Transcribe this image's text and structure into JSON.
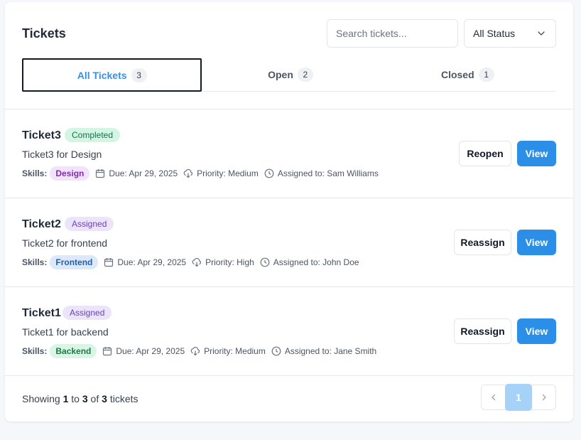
{
  "header": {
    "title": "Tickets",
    "search_placeholder": "Search tickets...",
    "status_filter": "All Status"
  },
  "tabs": [
    {
      "label": "All Tickets",
      "count": "3"
    },
    {
      "label": "Open",
      "count": "2"
    },
    {
      "label": "Closed",
      "count": "1"
    }
  ],
  "tickets": [
    {
      "name": "Ticket3",
      "status": "Completed",
      "description": "Ticket3 for Design",
      "skills_label": "Skills:",
      "skill": "Design",
      "due": "Due: Apr 29, 2025",
      "priority": "Priority: Medium",
      "assigned": "Assigned to: Sam Williams",
      "action": "Reopen",
      "view": "View"
    },
    {
      "name": "Ticket2",
      "status": "Assigned",
      "description": "Ticket2 for frontend",
      "skills_label": "Skills:",
      "skill": "Frontend",
      "due": "Due: Apr 29, 2025",
      "priority": "Priority: High",
      "assigned": "Assigned to: John Doe",
      "action": "Reassign",
      "view": "View"
    },
    {
      "name": "Ticket1",
      "status": "Assigned",
      "description": "Ticket1 for backend",
      "skills_label": "Skills:",
      "skill": "Backend",
      "due": "Due: Apr 29, 2025",
      "priority": "Priority: Medium",
      "assigned": "Assigned to: Jane Smith",
      "action": "Reassign",
      "view": "View"
    }
  ],
  "footer": {
    "showing_prefix": "Showing",
    "from": "1",
    "to_word": "to",
    "to": "3",
    "of_word": "of",
    "total": "3",
    "suffix": "tickets",
    "current_page": "1"
  },
  "colors": {
    "primary": "#2b8fe8",
    "active_tab": "#3b8fe0",
    "completed_bg": "#d3f5e4",
    "assigned_bg": "#ece4fb"
  }
}
